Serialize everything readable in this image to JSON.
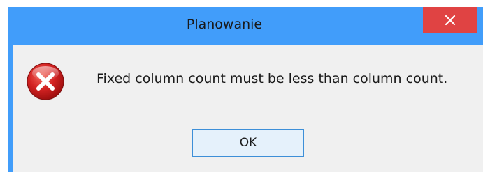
{
  "window": {
    "title": "Planowanie",
    "close_icon": "close-icon"
  },
  "dialog": {
    "icon": "error-icon",
    "message": "Fixed column count must be less than column count.",
    "ok_label": "OK"
  },
  "colors": {
    "titlebar": "#419dfa",
    "close_button": "#e04343",
    "client_background": "#f0f0f0",
    "ok_button": "#e5f1fb",
    "ok_border": "#3d8fd8",
    "error_red": "#d01c1c"
  }
}
